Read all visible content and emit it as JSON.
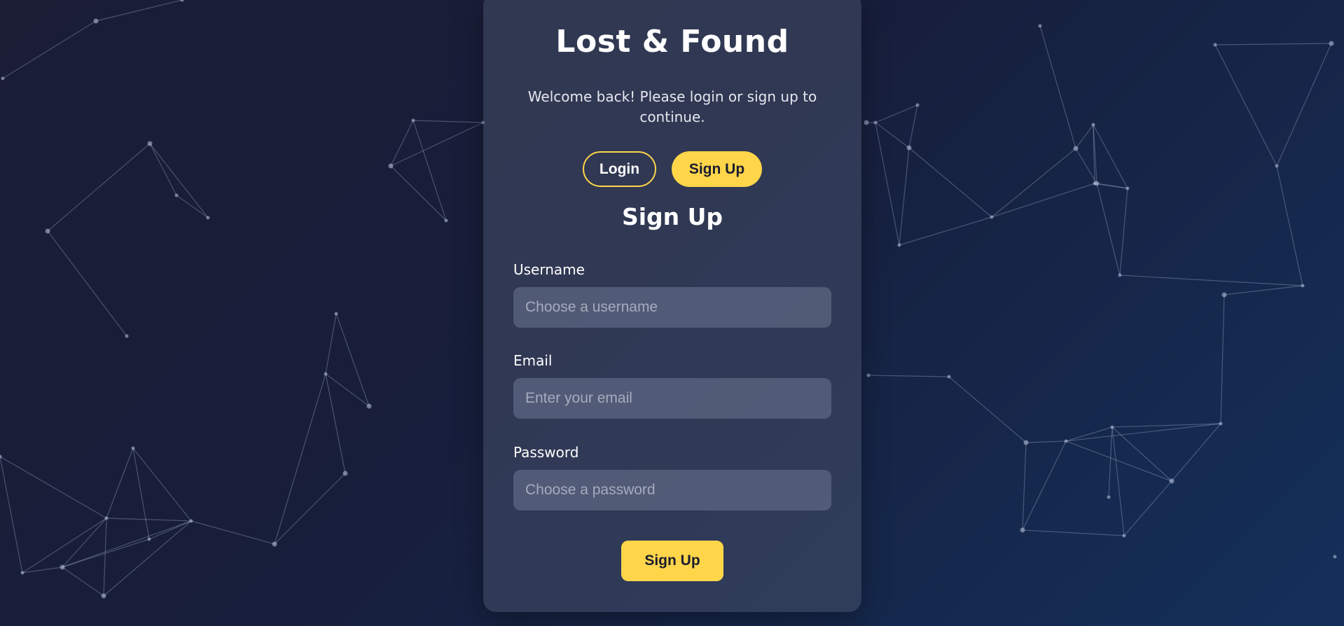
{
  "app": {
    "title": "Lost & Found",
    "welcome": "Welcome back! Please login or sign up to continue."
  },
  "toggle": {
    "login_label": "Login",
    "signup_label": "Sign Up",
    "active": "signup"
  },
  "form": {
    "heading": "Sign Up",
    "username_label": "Username",
    "username_placeholder": "Choose a username",
    "username_value": "",
    "email_label": "Email",
    "email_placeholder": "Enter your email",
    "email_value": "",
    "password_label": "Password",
    "password_placeholder": "Choose a password",
    "password_value": "",
    "submit_label": "Sign Up"
  },
  "colors": {
    "accent": "#ffd54a",
    "background_start": "#1b1d35",
    "background_end": "#14305a"
  }
}
